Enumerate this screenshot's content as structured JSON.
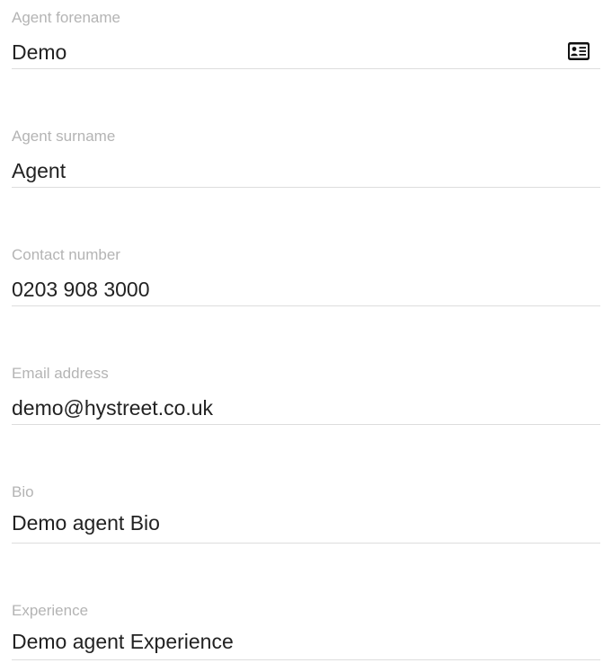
{
  "form": {
    "fields": [
      {
        "label": "Agent forename",
        "value": "Demo"
      },
      {
        "label": "Agent surname",
        "value": "Agent"
      },
      {
        "label": "Contact number",
        "value": "0203 908 3000"
      },
      {
        "label": "Email address",
        "value": "demo@hystreet.co.uk"
      },
      {
        "label": "Bio",
        "value": "Demo agent Bio"
      },
      {
        "label": "Experience",
        "value": "Demo agent Experience"
      }
    ],
    "autofill_icon": "contact-card-icon"
  },
  "colors": {
    "label": "#b4b4b4",
    "value": "#222222",
    "underline": "#dddddd",
    "icon": "#111111"
  }
}
